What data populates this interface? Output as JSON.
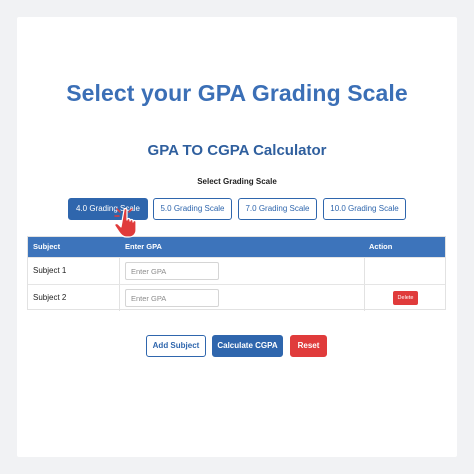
{
  "headline": "Select your GPA Grading Scale",
  "calculator": {
    "title": "GPA TO CGPA Calculator",
    "scale_label": "Select Grading Scale",
    "scales": [
      "4.0 Grading Scale",
      "5.0 Grading Scale",
      "7.0 Grading Scale",
      "10.0 Grading Scale"
    ],
    "active_scale": "4.0 Grading Scale"
  },
  "table": {
    "headers": [
      "Subject",
      "Enter GPA",
      "Action"
    ],
    "rows": [
      {
        "subject": "Subject 1",
        "gpa_value": "",
        "gpa_placeholder": "Enter GPA",
        "action": ""
      },
      {
        "subject": "Subject 2",
        "gpa_value": "",
        "gpa_placeholder": "Enter GPA",
        "action": "Delete"
      }
    ]
  },
  "actions": {
    "add_label": "Add Subject",
    "calculate_label": "Calculate CGPA",
    "reset_label": "Reset"
  },
  "colors": {
    "accent": "#2f66ad",
    "headline": "#3b6fb6",
    "header_row": "#3d74bb",
    "danger": "#e03b3b",
    "pointer": "#e03b3b"
  },
  "icons": {
    "cursor": "hand-pointer-icon"
  }
}
